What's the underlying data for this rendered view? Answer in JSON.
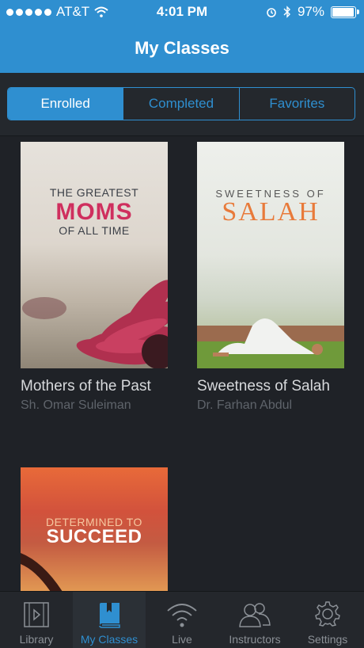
{
  "status": {
    "carrier": "AT&T",
    "time": "4:01 PM",
    "battery": "97%",
    "battery_level": 0.97
  },
  "nav": {
    "title": "My Classes"
  },
  "segments": [
    {
      "label": "Enrolled",
      "active": true
    },
    {
      "label": "Completed",
      "active": false
    },
    {
      "label": "Favorites",
      "active": false
    }
  ],
  "classes": [
    {
      "title": "Mothers of the Past",
      "author": "Sh. Omar Suleiman",
      "cover_line1": "THE GREATEST",
      "cover_line2": "MOMS",
      "cover_line3": "OF ALL TIME"
    },
    {
      "title": "Sweetness of Salah",
      "author": "Dr. Farhan Abdul",
      "cover_line1": "SWEETNESS OF",
      "cover_line2": "SALAH"
    },
    {
      "cover_line1": "DETERMINED TO",
      "cover_line2": "SUCCEED"
    }
  ],
  "tabs": [
    {
      "label": "Library",
      "icon": "film-icon"
    },
    {
      "label": "My Classes",
      "icon": "book-icon",
      "active": true
    },
    {
      "label": "Live",
      "icon": "wifi-icon"
    },
    {
      "label": "Instructors",
      "icon": "people-icon"
    },
    {
      "label": "Settings",
      "icon": "gear-icon"
    }
  ],
  "colors": {
    "accent": "#2f8fd0",
    "background": "#1f2227"
  }
}
